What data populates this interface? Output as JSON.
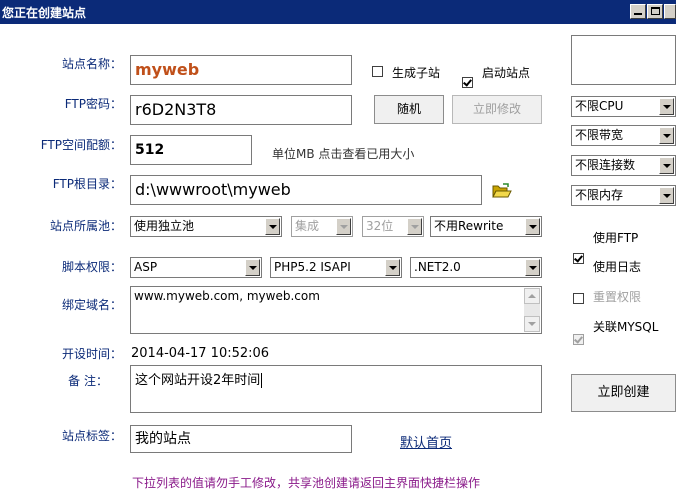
{
  "window": {
    "title": "您正在创建站点"
  },
  "form": {
    "site_name": {
      "label": "站点名称：",
      "value": "myweb"
    },
    "create_subsite": {
      "label": "生成子站",
      "checked": false
    },
    "enable_site": {
      "label": "启动站点",
      "checked": true
    },
    "ftp_password": {
      "label": "FTP密码：",
      "value": "r6D2N3T8"
    },
    "random_button": "随机",
    "modify_button": "立即修改",
    "ftp_quota": {
      "label": "FTP空间配额：",
      "value": "512",
      "hint": "单位MB 点击查看已用大小"
    },
    "ftp_root": {
      "label": "FTP根目录：",
      "value": "d:\\wwwroot\\myweb"
    },
    "pool": {
      "label": "站点所属池：",
      "pool_value": "使用独立池",
      "mode_value": "集成",
      "bits_value": "32位",
      "rewrite_value": "不用Rewrite"
    },
    "script": {
      "label": "脚本权限：",
      "asp_value": "ASP",
      "php_value": "PHP5.2 ISAPI",
      "net_value": ".NET2.0"
    },
    "domains": {
      "label": "绑定域名：",
      "value": "www.myweb.com, myweb.com"
    },
    "created_time": {
      "label": "开设时间：",
      "value": "2014-04-17 10:52:06"
    },
    "remark": {
      "label": "备 注：",
      "value": "这个网站开设2年时间"
    },
    "site_tag": {
      "label": "站点标签：",
      "value": "我的站点"
    },
    "default_home_link": "默认首页",
    "footer_note": "下拉列表的值请勿手工修改，共享池创建请返回主界面快捷栏操作"
  },
  "limits": {
    "cpu": "不限CPU",
    "bandwidth": "不限带宽",
    "connections": "不限连接数",
    "memory": "不限内存"
  },
  "options": {
    "use_ftp": {
      "label": "使用FTP",
      "checked": true
    },
    "use_log": {
      "label": "使用日志",
      "checked": false
    },
    "reset_perm": {
      "label": "重置权限",
      "checked": true,
      "disabled": true
    },
    "link_mysql": {
      "label": "关联MYSQL",
      "checked": true
    }
  },
  "create_button": "立即创建",
  "icons": {
    "folder": "folder-open-icon"
  },
  "colors": {
    "titlebar": "#0b2a78",
    "label": "#0b2a78",
    "site_name_text": "#c0501a",
    "note": "#8a1a8a"
  }
}
